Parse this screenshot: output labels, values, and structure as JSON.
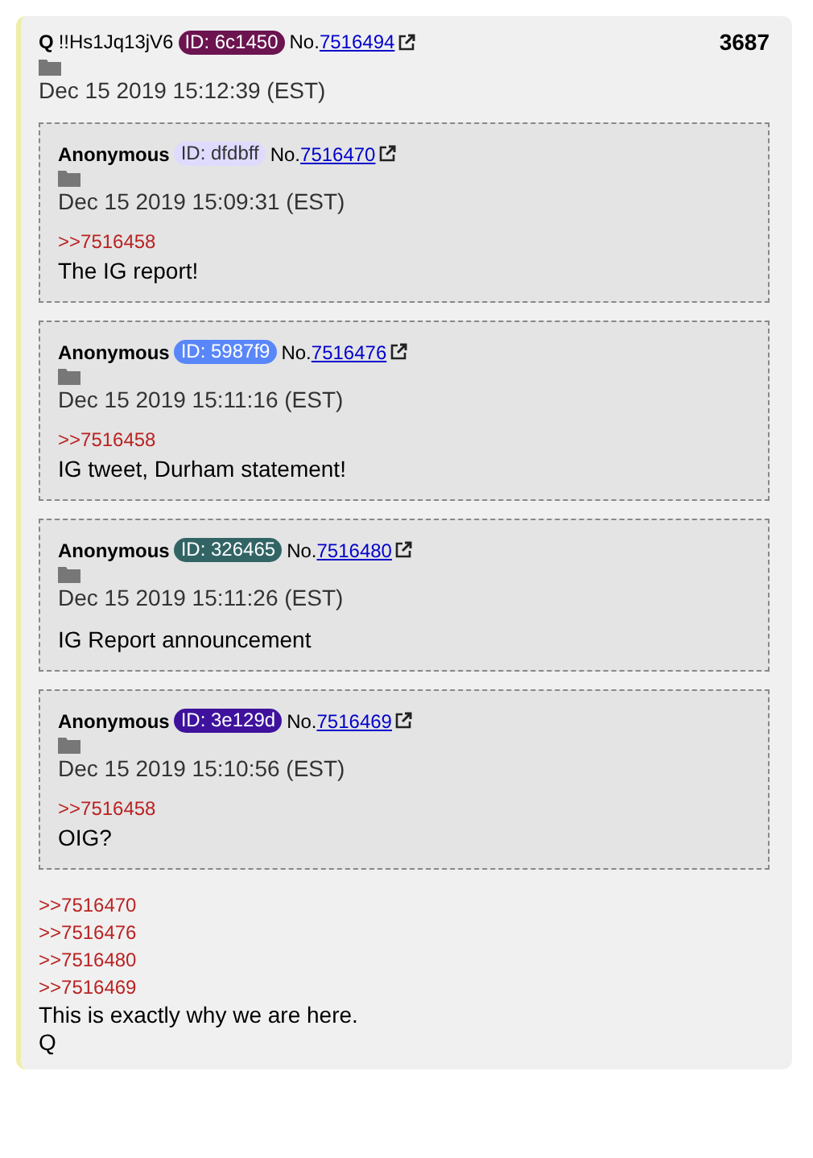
{
  "post": {
    "name": "Q",
    "tripcode": "!!Hs1Jq13jV6",
    "id_badge": {
      "label": "ID: 6c1450",
      "color": "#6c1450"
    },
    "number_prefix": "No.",
    "number": "7516494",
    "count": "3687",
    "date": "Dec 15 2019 15:12:39 (EST)",
    "quoted_posts": [
      {
        "name": "Anonymous",
        "id_badge": {
          "label": "ID: dfdbff",
          "color": "#dfdbff"
        },
        "number_prefix": "No.",
        "number": "7516470",
        "date": "Dec 15 2019 15:09:31 (EST)",
        "reply_link": ">>7516458",
        "text": "The IG report!"
      },
      {
        "name": "Anonymous",
        "id_badge": {
          "label": "ID: 5987f9",
          "color": "#5987f9"
        },
        "number_prefix": "No.",
        "number": "7516476",
        "date": "Dec 15 2019 15:11:16 (EST)",
        "reply_link": ">>7516458",
        "text": "IG tweet, Durham statement!"
      },
      {
        "name": "Anonymous",
        "id_badge": {
          "label": "ID: 326465",
          "color": "#326465"
        },
        "number_prefix": "No.",
        "number": "7516480",
        "date": "Dec 15 2019 15:11:26 (EST)",
        "text": "IG Report announcement"
      },
      {
        "name": "Anonymous",
        "id_badge": {
          "label": "ID: 3e129d",
          "color": "#3e129d"
        },
        "number_prefix": "No.",
        "number": "7516469",
        "date": "Dec 15 2019 15:10:56 (EST)",
        "reply_link": ">>7516458",
        "text": "OIG?"
      }
    ],
    "reply_links": [
      ">>7516470",
      ">>7516476",
      ">>7516480",
      ">>7516469"
    ],
    "body_lines": [
      "This is exactly why we are here.",
      "Q"
    ]
  }
}
